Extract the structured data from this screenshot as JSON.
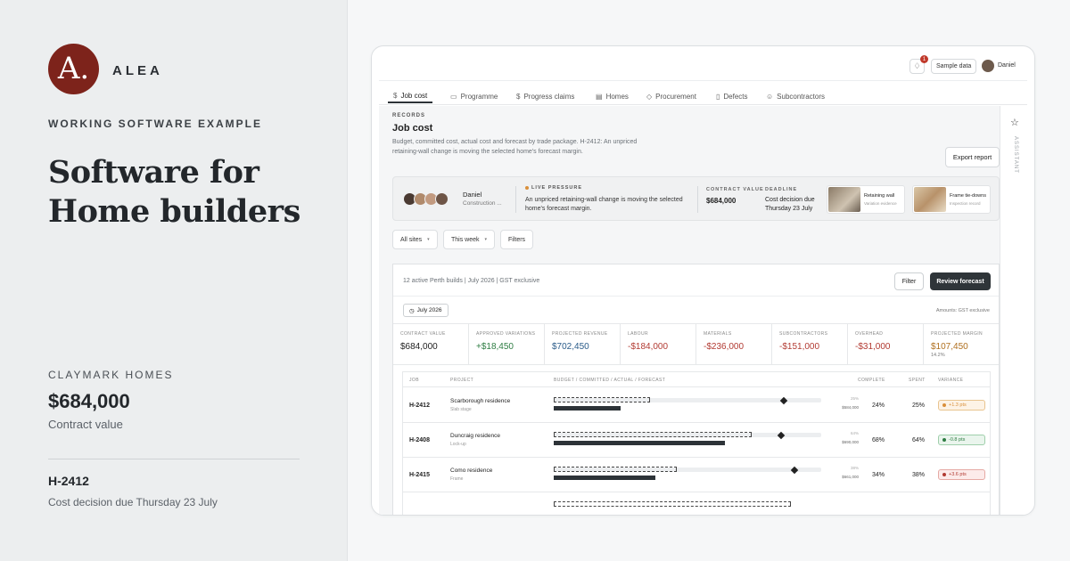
{
  "brand": {
    "logo_letter": "A.",
    "name": "ALEA",
    "color": "#7d231b"
  },
  "hero": {
    "eyebrow": "WORKING SOFTWARE EXAMPLE",
    "headline": "Software for Home builders",
    "client": "CLAYMARK HOMES",
    "amount": "$684,000",
    "amount_label": "Contract value",
    "job_id": "H-2412",
    "job_note": "Cost decision due Thursday 23 July"
  },
  "app": {
    "notification_count": "1",
    "sample_label": "Sample data",
    "user": "Daniel",
    "tabs": [
      {
        "icon": "$",
        "label": "Job cost"
      },
      {
        "icon": "▭",
        "label": "Programme"
      },
      {
        "icon": "$",
        "label": "Progress claims"
      },
      {
        "icon": "▤",
        "label": "Homes"
      },
      {
        "icon": "◇",
        "label": "Procurement"
      },
      {
        "icon": "▯",
        "label": "Defects"
      },
      {
        "icon": "☺",
        "label": "Subcontractors"
      }
    ],
    "assistant_label": "ASSISTANT",
    "records_label": "RECORDS",
    "page_title": "Job cost",
    "page_desc": "Budget, committed cost, actual cost and forecast by trade package. H-2412: An unpriced retaining-wall change is moving the selected home's forecast margin.",
    "export_label": "Export report",
    "summary": {
      "name": "Daniel",
      "role": "Construction ...",
      "live_label": "LIVE PRESSURE",
      "live_text": "An unpriced retaining-wall change is moving the selected home's forecast margin.",
      "contract_label": "CONTRACT VALUE",
      "contract_value": "$684,000",
      "deadline_label": "DEADLINE",
      "deadline_value": "Cost decision due Thursday 23 July",
      "thumbs": [
        {
          "title": "Retaining wall",
          "sub": "Variation evidence"
        },
        {
          "title": "Frame tie-downs",
          "sub": "Inspection record"
        }
      ]
    },
    "filters": [
      {
        "label": "All sites",
        "chev": "▾"
      },
      {
        "label": "This week",
        "chev": "▾"
      },
      {
        "label": "Filters",
        "chev": ""
      }
    ],
    "panel": {
      "info": "12 active Perth builds | July 2026 | GST exclusive",
      "filter_label": "Filter",
      "review_label": "Review forecast",
      "date_chip": "July 2026",
      "amounts_note": "Amounts: GST exclusive"
    },
    "kpis": [
      {
        "label": "CONTRACT VALUE",
        "value": "$684,000",
        "sub": "",
        "color": "#222222"
      },
      {
        "label": "APPROVED VARIATIONS",
        "value": "+$18,450",
        "sub": "",
        "color": "#2e7d43"
      },
      {
        "label": "PROJECTED REVENUE",
        "value": "$702,450",
        "sub": "",
        "color": "#2b5c8a"
      },
      {
        "label": "LABOUR",
        "value": "-$184,000",
        "sub": "",
        "color": "#b23a32"
      },
      {
        "label": "MATERIALS",
        "value": "-$236,000",
        "sub": "",
        "color": "#b23a32"
      },
      {
        "label": "SUBCONTRACTORS",
        "value": "-$151,000",
        "sub": "",
        "color": "#b23a32"
      },
      {
        "label": "OVERHEAD",
        "value": "-$31,000",
        "sub": "",
        "color": "#b23a32"
      },
      {
        "label": "PROJECTED MARGIN",
        "value": "$107,450",
        "sub": "14.2%",
        "color": "#b0701f"
      }
    ],
    "table": {
      "headers": {
        "job": "JOB",
        "project": "PROJECT",
        "bars": "BUDGET / COMMITTED / ACTUAL / FORECAST",
        "complete": "COMPLETE",
        "spent": "SPENT",
        "variance": "VARIANCE"
      },
      "rows": [
        {
          "job": "H-2412",
          "project": "Scarborough residence",
          "stage": "Slab stage",
          "committed": 0.36,
          "actual": 0.25,
          "forecast": 0.85,
          "pct_small": "25%",
          "amt_small": "$584,000",
          "complete": "24%",
          "spent": "25%",
          "variance": "+1.3 pts",
          "var_bg": "#fdf3e6",
          "var_border": "#e9c48f",
          "var_dot": "#d98f3a"
        },
        {
          "job": "H-2408",
          "project": "Duncraig residence",
          "stage": "Lock-up",
          "committed": 0.74,
          "actual": 0.64,
          "forecast": 0.84,
          "pct_small": "64%",
          "amt_small": "$690,000",
          "complete": "68%",
          "spent": "64%",
          "variance": "-0.8 pts",
          "var_bg": "#eaf5ed",
          "var_border": "#9fcfab",
          "var_dot": "#2e7d43"
        },
        {
          "job": "H-2415",
          "project": "Como residence",
          "stage": "Frame",
          "committed": 0.46,
          "actual": 0.38,
          "forecast": 0.89,
          "pct_small": "38%",
          "amt_small": "$661,000",
          "complete": "34%",
          "spent": "38%",
          "variance": "+3.6 pts",
          "var_bg": "#fcebea",
          "var_border": "#e6a9a4",
          "var_dot": "#b23a32"
        }
      ]
    }
  }
}
